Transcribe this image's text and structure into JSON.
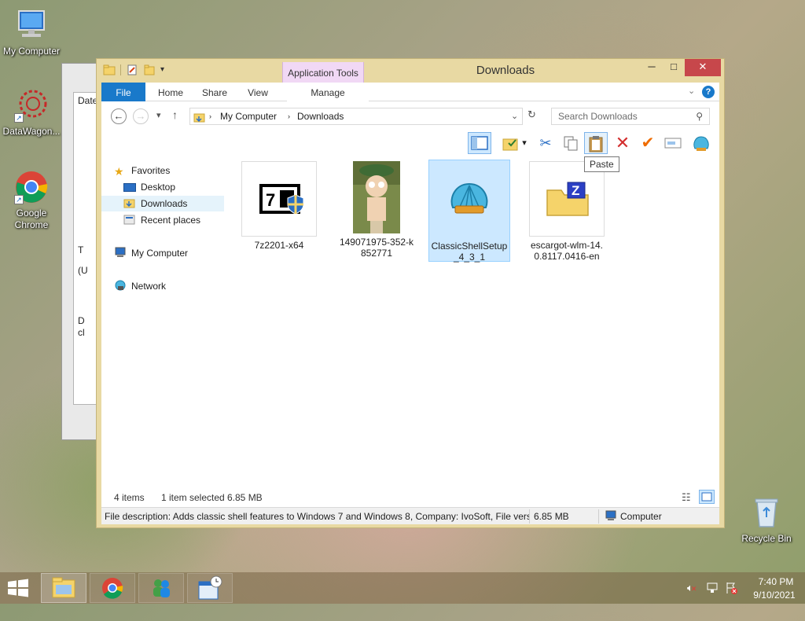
{
  "desktop": {
    "icons": [
      {
        "label": "My Computer"
      },
      {
        "label": "DataWagon..."
      },
      {
        "label": "Google Chrome"
      },
      {
        "label": "Recycle Bin"
      }
    ]
  },
  "bg_window": {
    "lines": [
      "Date",
      "T",
      "(U",
      "D",
      "cl"
    ]
  },
  "window": {
    "title": "Downloads",
    "context_tab": "Application Tools",
    "tabs": [
      "File",
      "Home",
      "Share",
      "View",
      "Manage"
    ]
  },
  "address": {
    "crumbs": [
      "My Computer",
      "Downloads"
    ],
    "search_placeholder": "Search Downloads"
  },
  "toolbar": {
    "tooltip": "Paste"
  },
  "nav_pane": {
    "favorites": "Favorites",
    "desktop": "Desktop",
    "downloads": "Downloads",
    "recent": "Recent places",
    "computer": "My Computer",
    "network": "Network"
  },
  "files": [
    {
      "name": "7z2201-x64"
    },
    {
      "name": "149071975-352-k852771"
    },
    {
      "name": "ClassicShellSetup_4_3_1"
    },
    {
      "name": "escargot-wlm-14.0.8117.0416-en"
    }
  ],
  "status": {
    "items": "4 items",
    "selected": "1 item selected",
    "size": "6.85 MB"
  },
  "details": {
    "description": "File description: Adds classic shell features to Windows 7 and Windows 8, Company: IvoSoft, File versio",
    "size": "6.85 MB",
    "location": "Computer"
  },
  "taskbar": {
    "time": "7:40 PM",
    "date": "9/10/2021"
  },
  "colors": {
    "accent": "#1979ca",
    "window_frame": "#e8d9a3",
    "selection": "#cce8ff",
    "close_button": "#c7474b",
    "context_tab": "#f1d8f5"
  }
}
